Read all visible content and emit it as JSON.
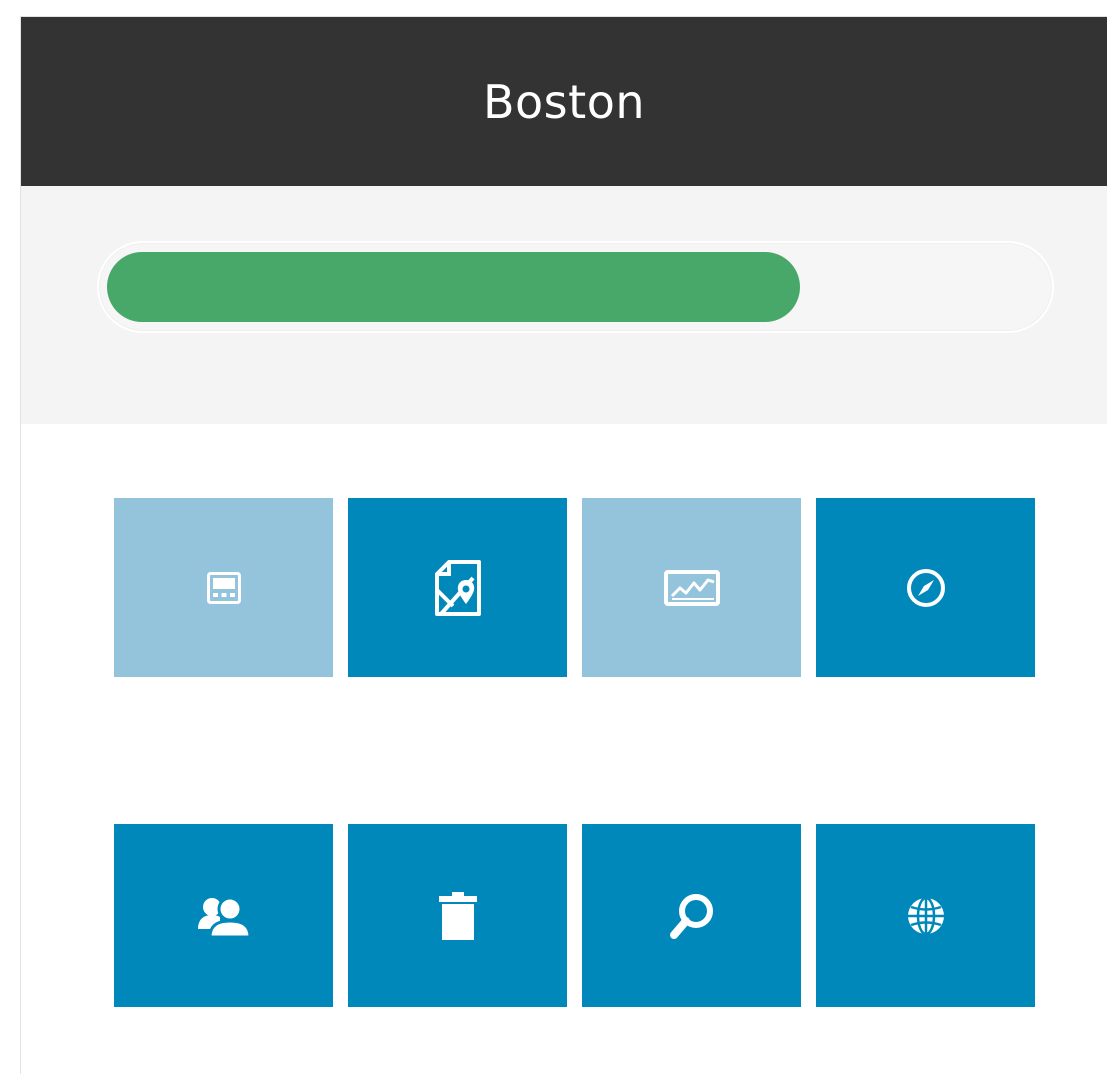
{
  "header": {
    "title": "Boston"
  },
  "progress": {
    "value_fraction": 0.74,
    "fill_color": "#47a86a"
  },
  "colors": {
    "header_bg": "#333333",
    "tile_light": "#94c3dc",
    "tile_dark": "#0088bb"
  },
  "tiles": [
    {
      "icon": "calculator-icon",
      "style": "light"
    },
    {
      "icon": "map-pin-icon",
      "style": "dark"
    },
    {
      "icon": "line-chart-icon",
      "style": "light"
    },
    {
      "icon": "compass-icon",
      "style": "dark"
    },
    {
      "icon": "users-icon",
      "style": "dark"
    },
    {
      "icon": "trash-icon",
      "style": "dark"
    },
    {
      "icon": "search-icon",
      "style": "dark"
    },
    {
      "icon": "globe-icon",
      "style": "dark"
    }
  ]
}
